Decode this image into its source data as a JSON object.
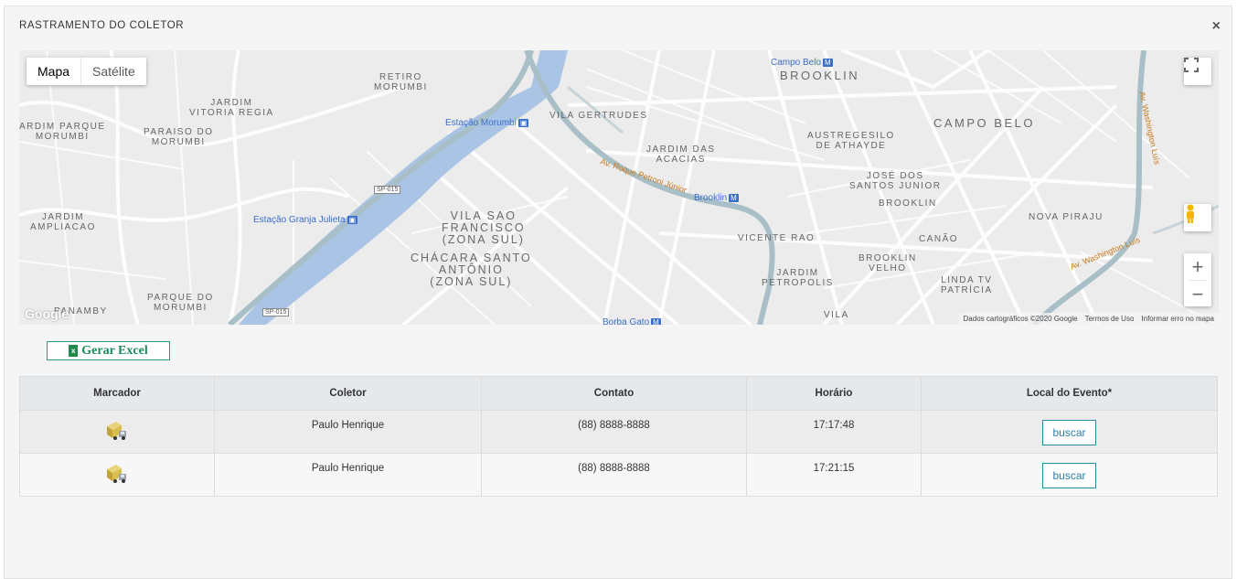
{
  "modal": {
    "title": "RASTRAMENTO DO COLETOR",
    "close": "×"
  },
  "map": {
    "type_buttons": [
      "Mapa",
      "Satélite"
    ],
    "fullscreen_icon": "fullscreen-icon",
    "zoom_in": "+",
    "zoom_out": "−",
    "google_logo": "Google",
    "attribution": [
      "Dados cartográficos ©2020 Google",
      "Termos de Uso",
      "Informar erro no mapa"
    ],
    "labels": {
      "retiro": "RETIRO\nMORUMBI",
      "jardim_vitoria": "JARDIM\nVITORIA REGIA",
      "jardim_parque": "ARDIM PARQUE\nMORUMBI",
      "paraiso": "PARAISO DO\nMORUMBI",
      "jardim_ampliacao": "JARDIM\nAMPLIACAO",
      "vila_gertrudes": "VILA GERTRUDES",
      "jardim_acacias": "JARDIM DAS\nACACIAS",
      "vila_sao_francisco": "VILA SAO\nFRANCISCO\n(ZONA SUL)",
      "chacara": "CHÁCARA SANTO\nANTÔNIO\n(ZONA SUL)",
      "brooklin": "BROOKLIN",
      "campo_belo": "CAMPO BELO",
      "austregesilo": "AUSTREGESILO\nDE ATHAYDE",
      "jose_dos_santos": "JOSÉ DOS\nSANTOS JUNIOR",
      "brooklin2": "BROOKLIN",
      "nova_piraju": "NOVA PIRAJU",
      "vicente_rao": "VICENTE RAO",
      "canao": "CANÃO",
      "jardim_petropolis": "JARDIM\nPETROPOLIS",
      "brooklin_velho": "BROOKLIN\nVELHO",
      "linda_tv": "LINDA TV\nPATRÍCIA",
      "parque_morumbi": "PARQUE DO\nMORUMBI",
      "panamby": "PANAMBY",
      "vila": "VILA"
    },
    "stations": {
      "campo_belo": "Campo Belo",
      "morumbi": "Estação Morumbi",
      "granja_julieta": "Estação Granja Julieta",
      "brooklin": "Brooklin",
      "borba_gato": "Borba Gato"
    },
    "roads": {
      "roque_petroni": "Av. Roque Petroni Júnior",
      "washington_luis": "Av. Washington Luís",
      "washington_luis_v": "Av. Washington Luís",
      "sp015": "SP-015"
    }
  },
  "excel_button": "Gerar Excel",
  "table": {
    "headers": [
      "Marcador",
      "Coletor",
      "Contato",
      "Horário",
      "Local do Evento*"
    ],
    "rows": [
      {
        "coletor": "Paulo Henrique",
        "contato": "(88) 8888-8888",
        "horario": "17:17:48",
        "action": "buscar"
      },
      {
        "coletor": "Paulo Henrique",
        "contato": "(88) 8888-8888",
        "horario": "17:21:15",
        "action": "buscar"
      }
    ]
  },
  "colors": {
    "river": "#aac4e6",
    "highway": "#a9bfc7",
    "accent_green": "#1a8a5a",
    "button_blue": "#2a7fa6"
  }
}
